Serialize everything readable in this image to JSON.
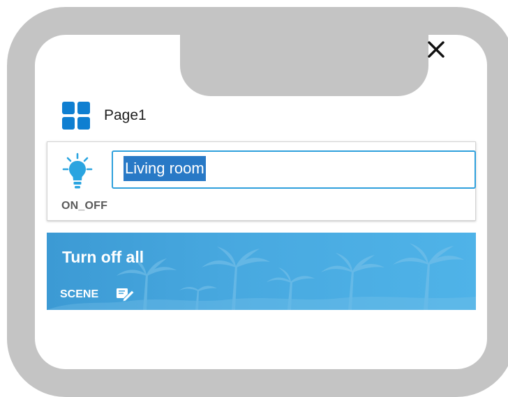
{
  "app": {
    "close_icon": "close-icon",
    "frame_color": "#c4c4c4"
  },
  "page": {
    "title": "Page1",
    "icon": "grid-icon",
    "icon_color": "#0f7fd1"
  },
  "widget": {
    "icon": "lightbulb-icon",
    "name_value": "Living room",
    "type_label": "ON_OFF",
    "accent_color": "#2ea0dc",
    "selection_color": "#2879c6"
  },
  "scene": {
    "title": "Turn off all",
    "label": "SCENE",
    "edit_icon": "edit-icon",
    "background_color": "#48a9e0"
  }
}
